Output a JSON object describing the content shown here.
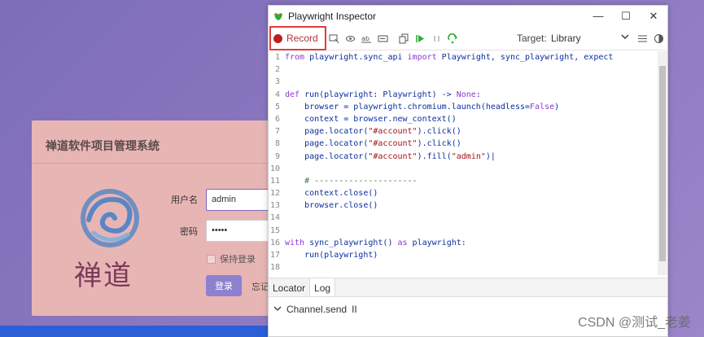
{
  "background_page": {
    "title": "禅道软件项目管理系统",
    "logo_text": "禅道",
    "username_label": "用户名",
    "username_value": "admin",
    "password_label": "密码",
    "password_value": "•••••",
    "remember_label": "保持登录",
    "login_button": "登录",
    "forgot_link": "忘记"
  },
  "inspector": {
    "window_title": "Playwright Inspector",
    "window_controls": {
      "minimize": "—",
      "maximize": "☐",
      "close": "✕"
    },
    "toolbar": {
      "record_label": "Record",
      "target_label": "Target:",
      "target_value": "Library",
      "icons": [
        "pick-locator-icon",
        "eye-icon",
        "text-icon",
        "form-icon",
        "copy-icon",
        "resume-icon",
        "pause-icon",
        "step-over-icon",
        "list-icon",
        "theme-icon"
      ]
    },
    "code_lines": [
      {
        "n": "1",
        "html": "<span class=\"kw\">from</span> playwright.sync_api <span class=\"kw\">import</span> Playwright, sync_playwright, expect"
      },
      {
        "n": "2",
        "html": ""
      },
      {
        "n": "3",
        "html": ""
      },
      {
        "n": "4",
        "html": "<span class=\"kw\">def</span> run(playwright: Playwright) -> <span class=\"kw\">None</span>:"
      },
      {
        "n": "5",
        "html": "    browser = playwright.chromium.launch(headless=<span class=\"kw\">False</span>)"
      },
      {
        "n": "6",
        "html": "    context = browser.new_context()"
      },
      {
        "n": "7",
        "html": "    page.locator(<span class=\"str\">\"#account\"</span>).click()"
      },
      {
        "n": "8",
        "html": "    page.locator(<span class=\"str\">\"#account\"</span>).click()"
      },
      {
        "n": "9",
        "html": "    page.locator(<span class=\"str\">\"#account\"</span>).fill(<span class=\"str\">\"admin\"</span>)|"
      },
      {
        "n": "10",
        "html": ""
      },
      {
        "n": "11",
        "html": "    <span class=\"cm\"># ---------------------</span>"
      },
      {
        "n": "12",
        "html": "    context.close()"
      },
      {
        "n": "13",
        "html": "    browser.close()"
      },
      {
        "n": "14",
        "html": ""
      },
      {
        "n": "15",
        "html": ""
      },
      {
        "n": "16",
        "html": "<span class=\"kw\">with</span> sync_playwright() <span class=\"kw\">as</span> playwright:"
      },
      {
        "n": "17",
        "html": "    run(playwright)"
      },
      {
        "n": "18",
        "html": ""
      }
    ],
    "bottom_tabs": [
      "Locator",
      "Log"
    ],
    "log_entry": "Channel.send",
    "log_pause_icon": "II"
  },
  "watermark": "CSDN @测试_老姜",
  "colors": {
    "record_highlight": "#e03a3a",
    "record_dot": "#b92121",
    "login_button": "#8d80cf",
    "card": "#e8b5b5"
  }
}
